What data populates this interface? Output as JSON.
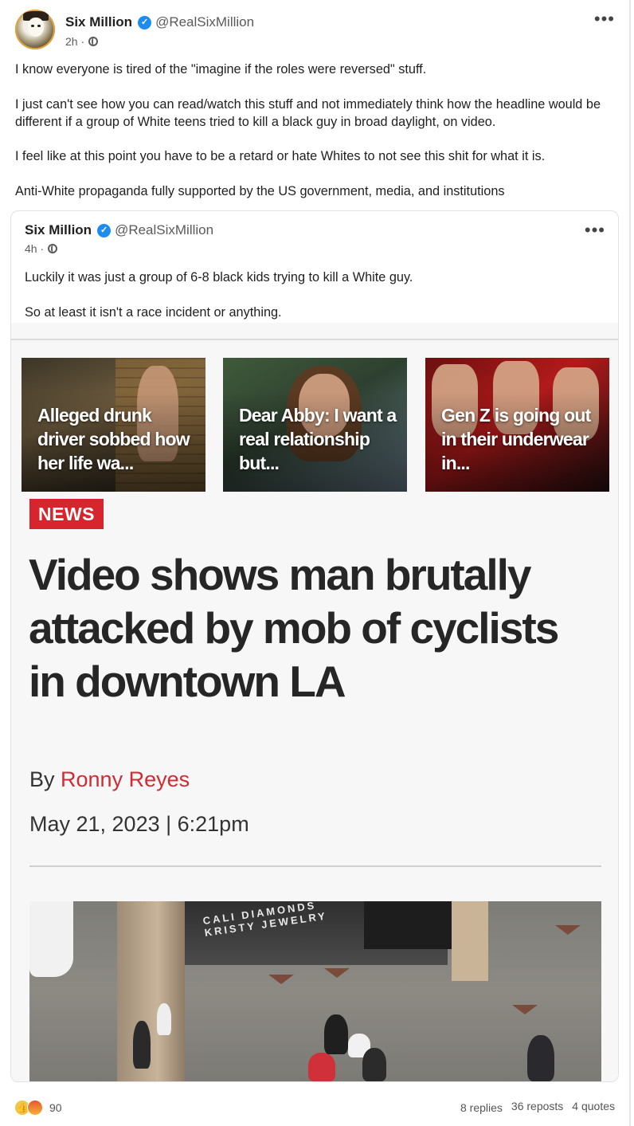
{
  "post": {
    "author_name": "Six Million",
    "author_handle": "@RealSixMillion",
    "timestamp": "2h",
    "more_label": "•••",
    "body": [
      "I know everyone is tired of the \"imagine if the roles were reversed\" stuff.",
      "I just can't see how you can read/watch this stuff and not immediately think how the headline would be different if a group of White teens tried to kill a black guy in broad daylight, on video.",
      "I feel like at this point you have to be a retard or hate Whites to not see this shit for what it is.",
      "Anti-White propaganda fully supported by the US government, media, and institutions"
    ]
  },
  "quoted_post": {
    "author_name": "Six Million",
    "author_handle": "@RealSixMillion",
    "timestamp": "4h",
    "more_label": "•••",
    "body": [
      "Luckily it was just a group of 6-8 black kids trying to kill a White guy.",
      "So at least it isn't a race incident or anything."
    ]
  },
  "article": {
    "promos": [
      {
        "caption": "Alleged drunk driver sobbed how her life wa..."
      },
      {
        "caption": "Dear Abby: I want a real relationship but..."
      },
      {
        "caption": "Gen Z is going out in their underwear in..."
      }
    ],
    "badge": "NEWS",
    "headline": "Video shows man brutally attacked by mob of cyclists in downtown LA",
    "byline_prefix": "By ",
    "author": "Ronny Reyes",
    "date": "May 21, 2023 | 6:21pm",
    "photo_sign": "CALI DIAMONDS KRISTY JEWELRY"
  },
  "footer": {
    "reaction_count": "90",
    "replies": "8 replies",
    "reposts": "36 reposts",
    "quotes": "4 quotes"
  },
  "colors": {
    "verified": "#1d8cf0",
    "news_red": "#d6252c",
    "author_red": "#cf2b32"
  },
  "icons": [
    "verified-badge-icon",
    "globe-icon",
    "more-icon",
    "thumbs-up-reaction-icon",
    "angry-reaction-icon"
  ]
}
